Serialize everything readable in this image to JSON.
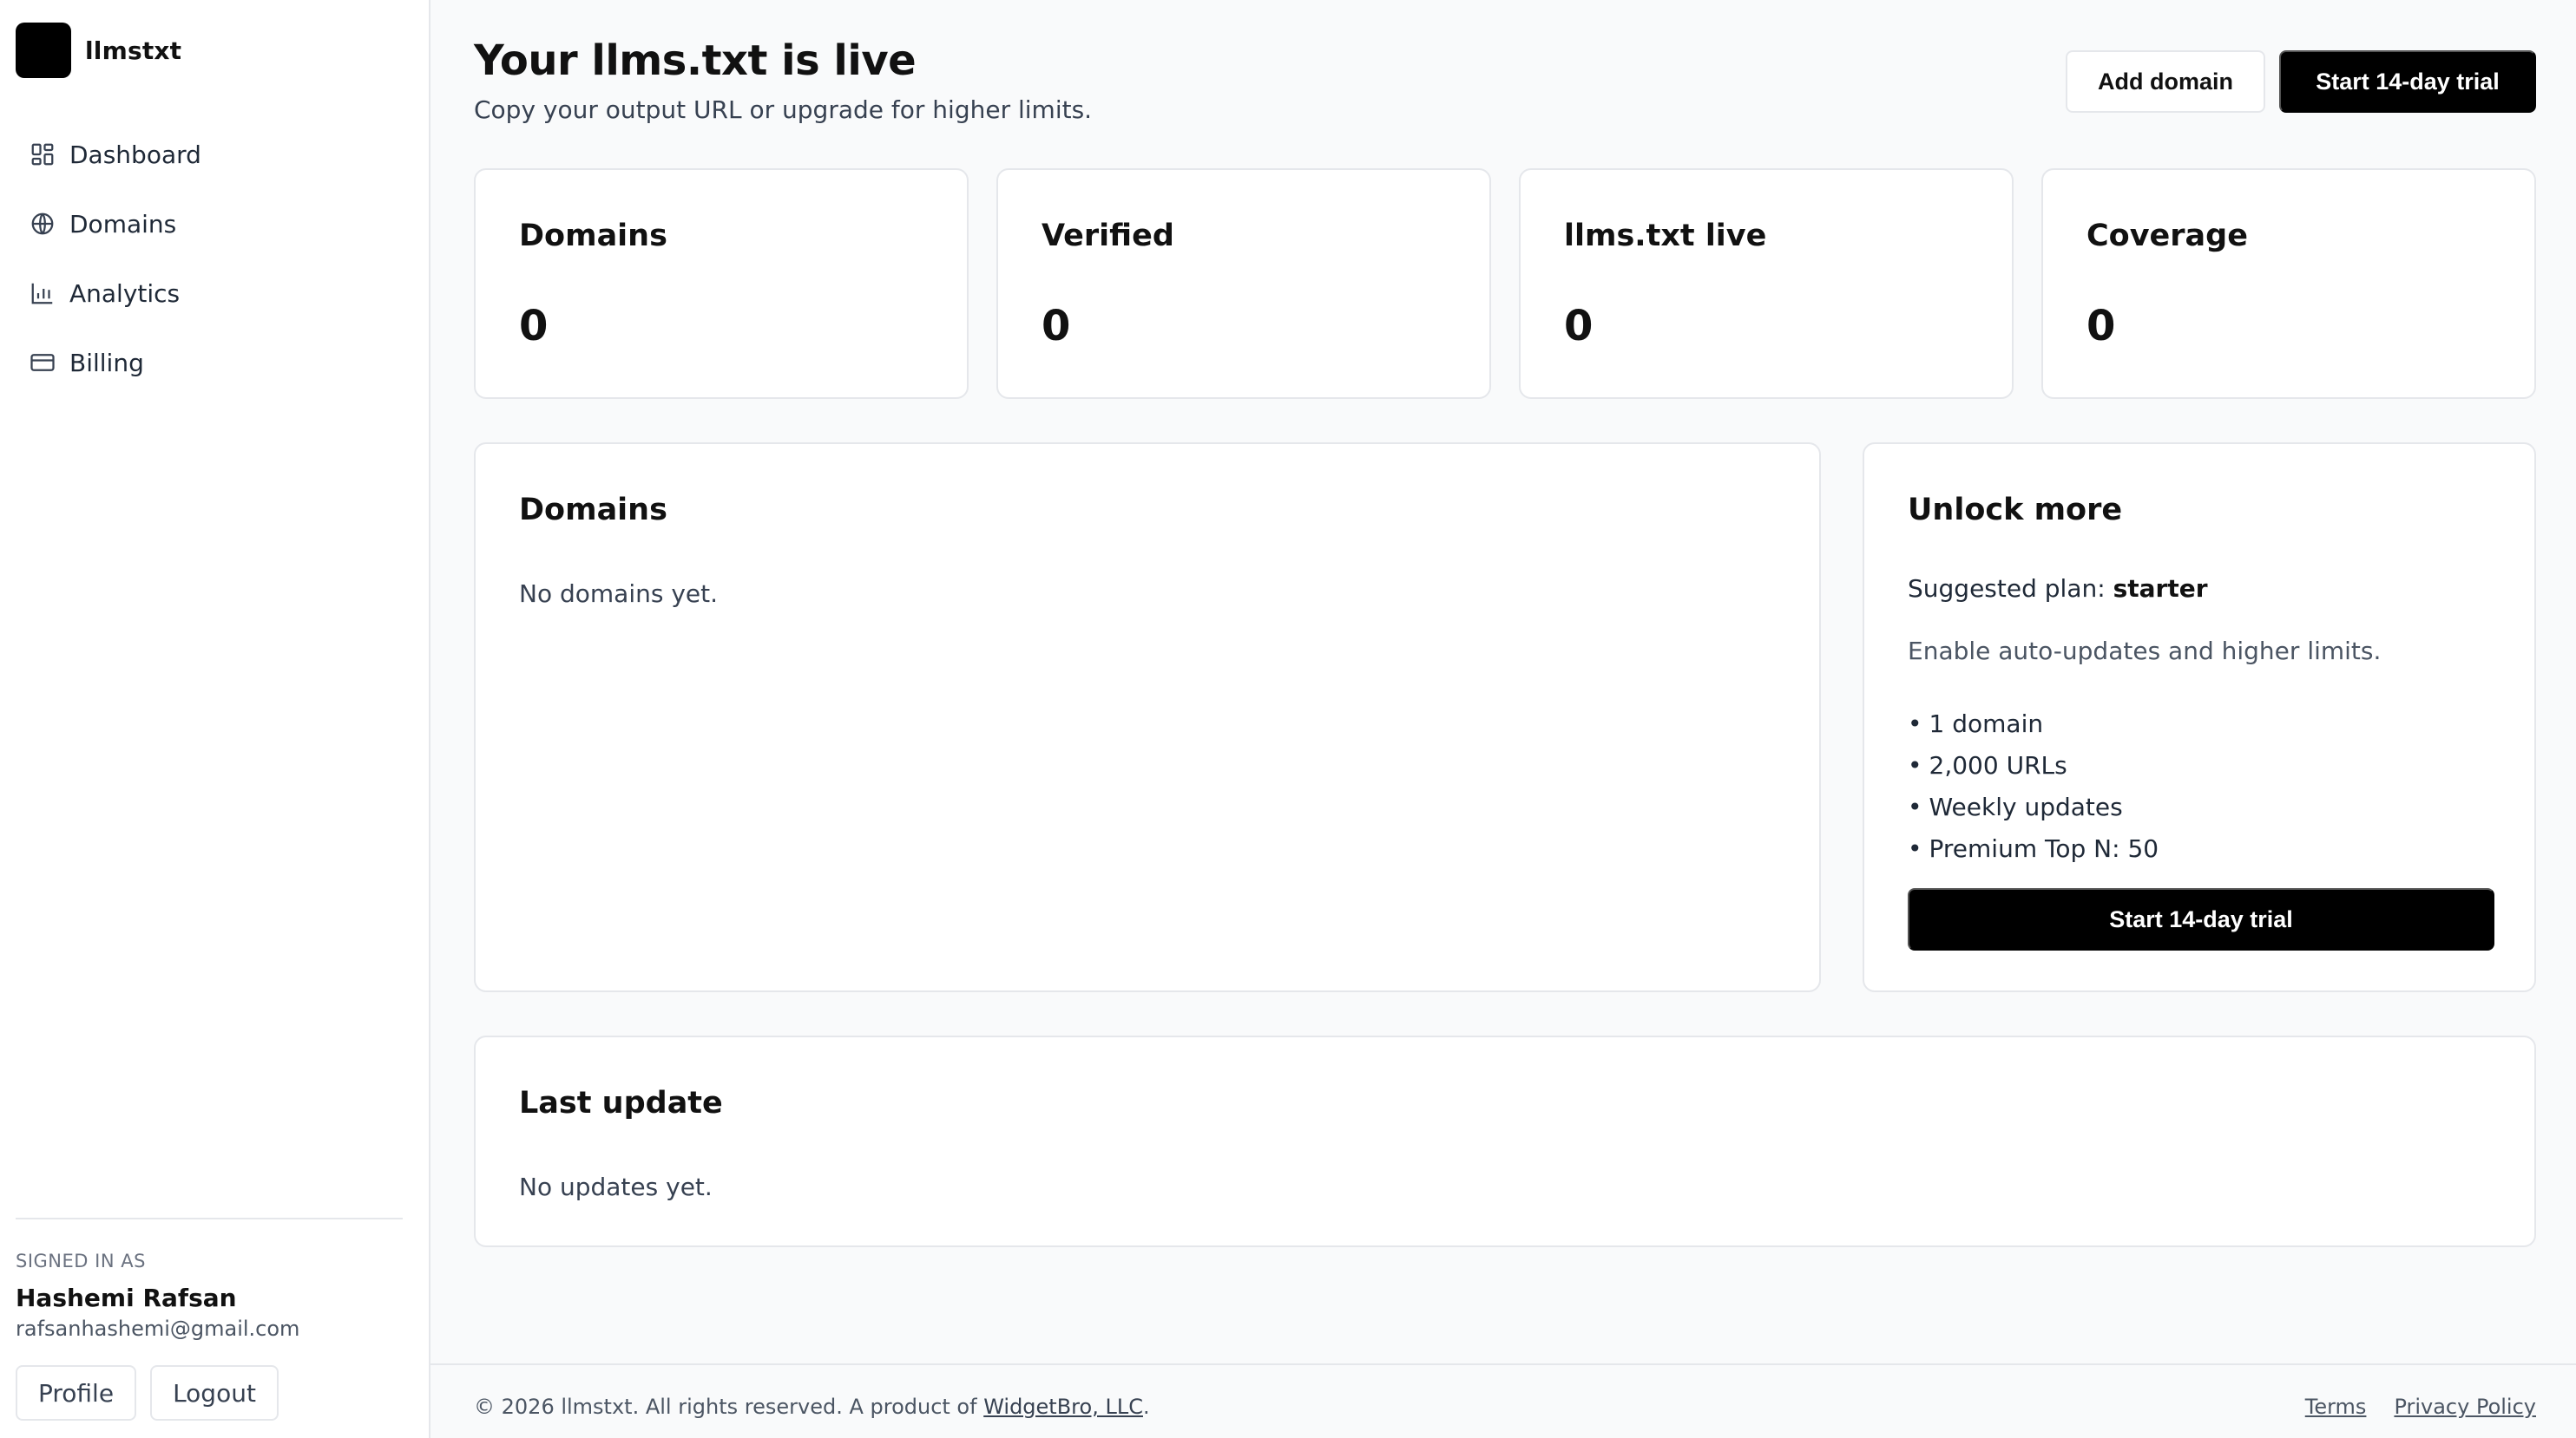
{
  "brand": {
    "name": "llmstxt"
  },
  "nav": {
    "items": [
      {
        "label": "Dashboard",
        "icon": "dashboard-icon"
      },
      {
        "label": "Domains",
        "icon": "globe-icon"
      },
      {
        "label": "Analytics",
        "icon": "bar-chart-icon"
      },
      {
        "label": "Billing",
        "icon": "credit-card-icon"
      }
    ]
  },
  "account": {
    "signed_in_label": "SIGNED IN AS",
    "name": "Hashemi Rafsan",
    "email": "rafsanhashemi@gmail.com",
    "profile_label": "Profile",
    "logout_label": "Logout"
  },
  "header": {
    "title": "Your llms.txt is live",
    "subtitle": "Copy your output URL or upgrade for higher limits.",
    "add_domain_label": "Add domain",
    "trial_label": "Start 14-day trial"
  },
  "stats": [
    {
      "label": "Domains",
      "value": "0"
    },
    {
      "label": "Verified",
      "value": "0"
    },
    {
      "label": "llms.txt live",
      "value": "0"
    },
    {
      "label": "Coverage",
      "value": "0"
    }
  ],
  "domains_panel": {
    "title": "Domains",
    "empty": "No domains yet."
  },
  "unlock": {
    "title": "Unlock more",
    "suggested_prefix": "Suggested plan:",
    "suggested_plan": "starter",
    "description": "Enable auto-updates and higher limits.",
    "features": [
      "1 domain",
      "2,000 URLs",
      "Weekly updates",
      "Premium Top N: 50"
    ],
    "cta_label": "Start 14-day trial"
  },
  "last_update": {
    "title": "Last update",
    "empty": "No updates yet."
  },
  "footer": {
    "copyright": "© 2026 llmstxt. All rights reserved. A product of",
    "company": "WidgetBro, LLC",
    "period": ".",
    "terms": "Terms",
    "privacy": "Privacy Policy"
  },
  "colors": {
    "accent": "#000000",
    "border": "#e5e7eb",
    "background": "#f9fafb"
  }
}
